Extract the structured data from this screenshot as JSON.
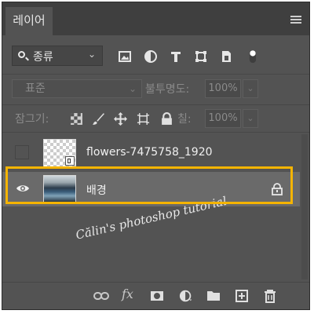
{
  "panel": {
    "tab_label": "레이어",
    "menu_icon": "panel-menu-icon"
  },
  "filter": {
    "kind_value": "종류",
    "icons": [
      "search-icon",
      "image-filter-icon",
      "adjustment-filter-icon",
      "type-filter-icon",
      "shape-filter-icon",
      "smart-object-filter-icon",
      "filter-toggle-icon"
    ]
  },
  "blend": {
    "mode": "표준",
    "opacity_label": "불투명도:",
    "opacity_value": "100%"
  },
  "lock": {
    "label": "잠그기:",
    "icons": [
      "lock-transparent-pixels-icon",
      "lock-image-pixels-icon",
      "lock-position-icon",
      "lock-artboard-icon",
      "lock-all-icon"
    ],
    "fill_label": "칠:",
    "fill_value": "100%"
  },
  "layers": [
    {
      "name": "flowers-7475758_1920",
      "visible": false,
      "selected": false,
      "smart_object": true
    },
    {
      "name": "배경",
      "visible": true,
      "selected": true,
      "locked": true
    }
  ],
  "watermark": "Călin's photoshop tutorial",
  "bottom_icons": [
    "link-layers-icon",
    "fx-icon",
    "mask-icon",
    "adjustment-layer-icon",
    "group-folder-icon",
    "new-layer-icon",
    "trash-icon"
  ],
  "colors": {
    "panel_bg": "#535353",
    "tab_bar": "#3f3f3f",
    "selection_row": "#6a6a6a",
    "highlight_frame": "#f5b400"
  }
}
